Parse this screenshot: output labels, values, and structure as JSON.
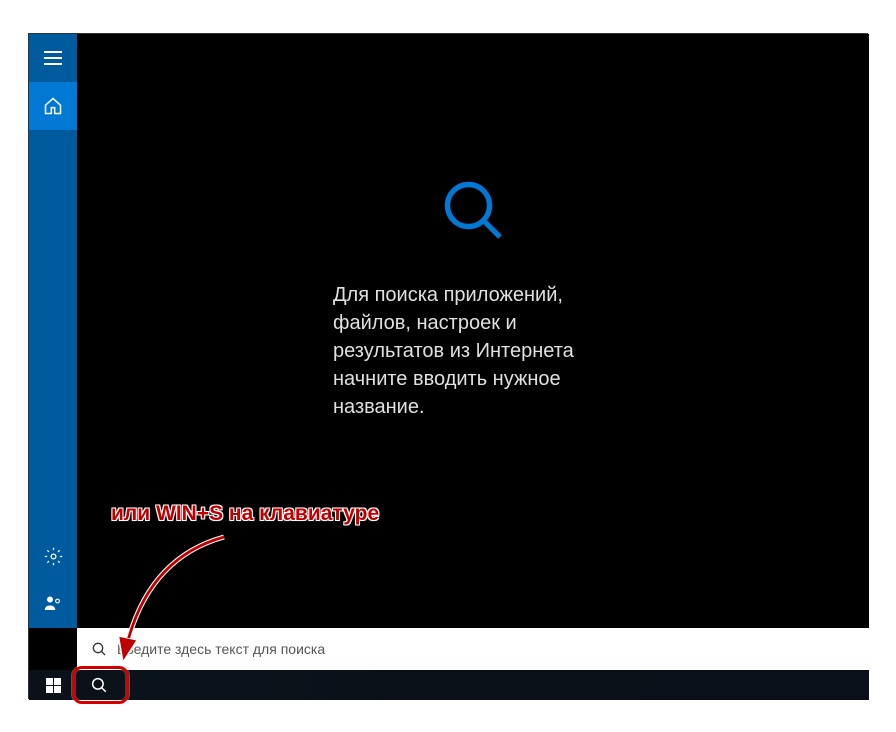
{
  "annotation": {
    "text": "или WIN+S на клавиатуре"
  },
  "sidebar": {
    "hamburger": "menu-icon",
    "home": "home-icon",
    "settings": "gear-icon",
    "feedback": "feedback-icon"
  },
  "main": {
    "big_icon": "search-icon",
    "instruction": "Для поиска приложений, файлов, настроек и результатов из Интернета начните вводить нужное название."
  },
  "search": {
    "placeholder": "Введите здесь текст для поиска",
    "value": ""
  },
  "taskbar": {
    "start": "windows-start",
    "search_button": "search-icon"
  },
  "colors": {
    "accent": "#0078d4",
    "sidebar": "#005a9e",
    "annotation_red": "#c00000"
  }
}
